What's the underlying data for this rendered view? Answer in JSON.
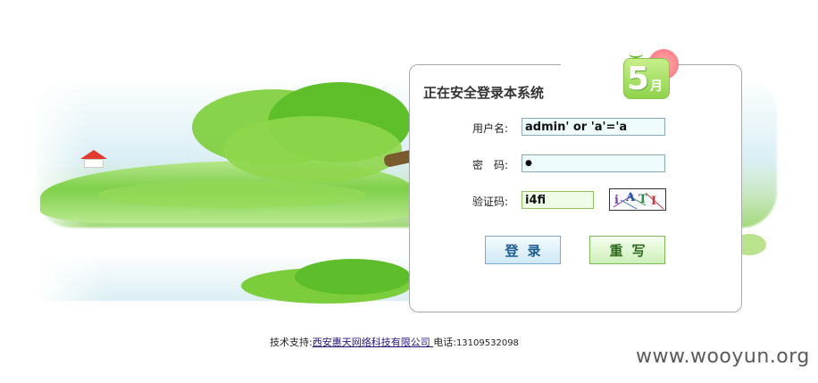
{
  "login": {
    "title": "正在安全登录本系统",
    "badge": {
      "number": "5",
      "month_char": "月"
    },
    "username_label": "用户名:",
    "username_value": "admin' or 'a'='a",
    "password_label": "密　码:",
    "password_value": "●",
    "captcha_label": "验证码:",
    "captcha_value": "i4fi",
    "captcha_image_text": [
      "i",
      "A",
      "T",
      "I"
    ],
    "login_button": "登录",
    "reset_button": "重写"
  },
  "footer": {
    "support_label": "技术支持:",
    "company_link": "西安惠天网络科技有限公司 ",
    "phone_label": "电话:",
    "phone_number": "13109532098"
  },
  "watermark": "www.wooyun.org",
  "colors": {
    "input_blue_bg": "#eefcfd",
    "input_green_bg": "#effde8",
    "login_button_text": "#1d5c93",
    "reset_button_text": "#2d6a1d",
    "link": "#2a1480"
  }
}
